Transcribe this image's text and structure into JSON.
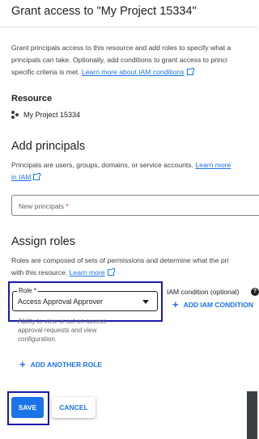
{
  "header": {
    "title": "Grant access to \"My Project 15334\""
  },
  "intro": {
    "line1": "Grant principals access to this resource and add roles to specify what a",
    "line2": "principals can take. Optionally, add conditions to grant access to princi",
    "line3_prefix": "specific criteria is met.",
    "link": "Learn more about IAM conditions"
  },
  "resource": {
    "label": "Resource",
    "project_name": "My Project 15334",
    "icon": "resource-manager-icon"
  },
  "add_principals": {
    "heading": "Add principals",
    "desc_prefix": "Principals are users, groups, domains, or service accounts.",
    "link_part1": "Learn more",
    "link_part2": "in IAM",
    "input_placeholder": "New principals",
    "required_mark": "*"
  },
  "assign_roles": {
    "heading": "Assign roles",
    "desc_line1": "Roles are composed of sets of permissions and determine what the pri",
    "desc_prefix2": "with this resource.",
    "link": "Learn more",
    "role_label": "Role",
    "required_mark": "*",
    "role_value": "Access Approval Approver",
    "helper_line1": "Ability to view or act on access",
    "helper_line2": "approval requests and view",
    "helper_line3": "configuration.",
    "iam_condition_label": "IAM condition (optional)",
    "help_icon_glyph": "?",
    "add_iam_condition": "ADD IAM CONDITION",
    "add_another_role": "ADD ANOTHER ROLE"
  },
  "footer": {
    "save": "SAVE",
    "cancel": "CANCEL"
  },
  "colors": {
    "accent": "#1a73e8",
    "highlight_outline": "#1a1ab0"
  }
}
